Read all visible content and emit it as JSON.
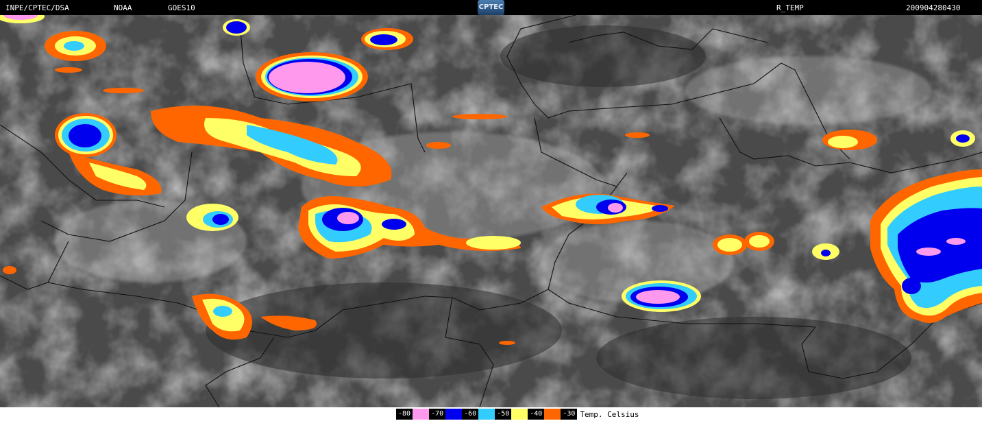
{
  "header": {
    "source": "INPE/CPTEC/DSA",
    "agency": "NOAA",
    "satellite": "GOES10",
    "logo": "CPTEC",
    "product": "R_TEMP",
    "timestamp": "200904280430"
  },
  "legend": {
    "items": [
      {
        "label": "-80",
        "color": "#ff99ee"
      },
      {
        "label": "-70",
        "color": "#0000ee"
      },
      {
        "label": "-60",
        "color": "#33ccff"
      },
      {
        "label": "-50",
        "color": "#ffff66"
      },
      {
        "label": "-40",
        "color": "#ff6600"
      },
      {
        "label": "-30",
        "color": "#000000"
      }
    ],
    "unit": "Temp. Celsius"
  }
}
